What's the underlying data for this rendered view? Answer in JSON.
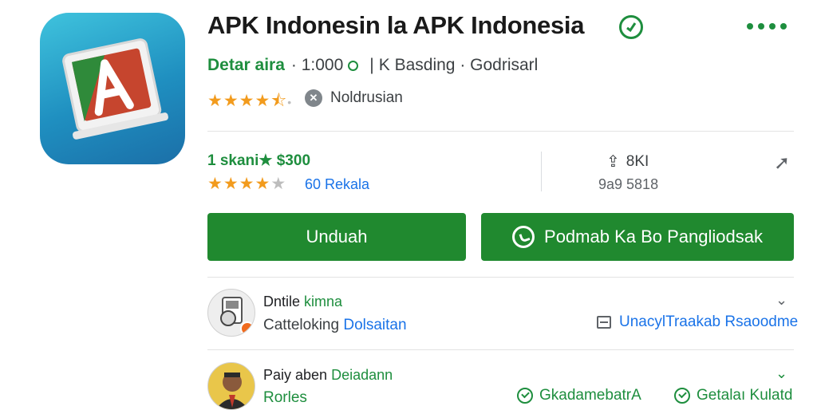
{
  "app": {
    "title": "APK Indonesin la APK Indonesia",
    "developer": "Detar aira",
    "meta_count": "· 1:000",
    "meta_rest": "K Basding · Godrisarl",
    "notif_label": "Noldrusian"
  },
  "stats": {
    "downloads_label": "1 skani★ $300",
    "reviews_link": "60 Rekala",
    "share_label": "8KI",
    "share_count": "9a9 5818"
  },
  "rating": {
    "stars": 4.5,
    "stars_row2": 4,
    "max": 5
  },
  "buttons": {
    "download": "Unduah",
    "contact": "Podmab Ka Bo Pangliodsak"
  },
  "items": [
    {
      "title_prefix": "Dntile",
      "title_highlight": "kimna",
      "sub_prefix": "Catteloking",
      "sub_highlight": "Dolsaitan",
      "right_link": "UnacylTraakab Rsaoodme"
    },
    {
      "title_prefix": "Paiy aben",
      "title_highlight": "Deiadann",
      "sub": "Rorles",
      "chip1": "GkadamebatrA",
      "chip2": "Getalaı Kulatd"
    }
  ],
  "icons": {
    "verified": "verified-check-icon",
    "more": "more-dots-icon",
    "share": "share-icon",
    "arrow": "arrow-icon",
    "whatsapp": "chat-icon",
    "policy": "policy-icon"
  },
  "colors": {
    "accent": "#20892f",
    "link": "#1a73e8",
    "star": "#f29b1d"
  }
}
